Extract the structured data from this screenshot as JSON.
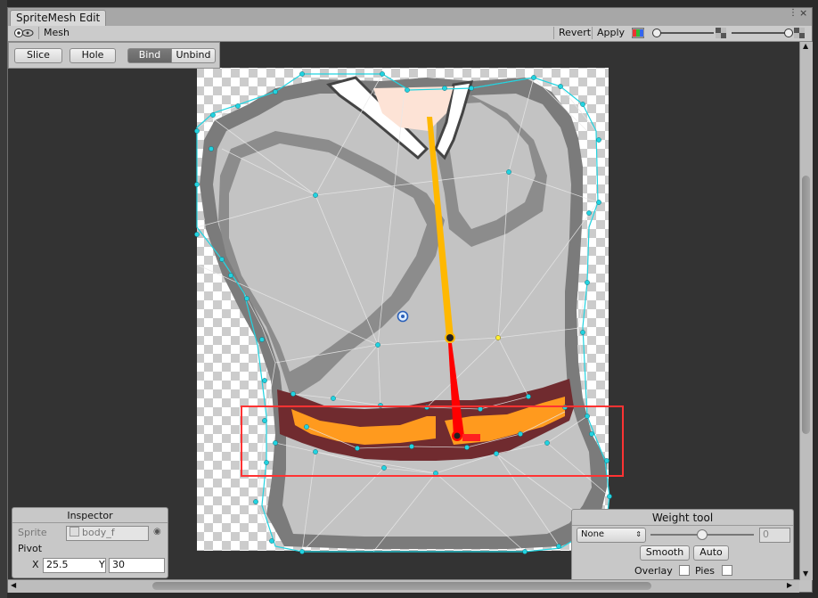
{
  "window": {
    "tab_title": "SpriteMesh Edit"
  },
  "toolbar": {
    "mesh_label": "Mesh",
    "revert_label": "Revert",
    "apply_label": "Apply"
  },
  "mode_bar": {
    "slice_label": "Slice",
    "hole_label": "Hole",
    "bind_label": "Bind",
    "unbind_label": "Unbind"
  },
  "inspector": {
    "title": "Inspector",
    "sprite_label": "Sprite",
    "sprite_value": "body_f",
    "pivot_label": "Pivot",
    "x_label": "X",
    "x_value": "25.5",
    "y_label": "Y",
    "y_value": "30"
  },
  "weight_tool": {
    "title": "Weight tool",
    "bone_select": "None",
    "weight_value": "0",
    "smooth_label": "Smooth",
    "auto_label": "Auto",
    "overlay_label": "Overlay",
    "pies_label": "Pies"
  },
  "colors": {
    "accent_cyan": "#22d3e0",
    "bone_orange": "#ffb800",
    "bone_red": "#ff0000",
    "selection_red": "#ff3333",
    "belt_orange": "#ff9a1e"
  }
}
